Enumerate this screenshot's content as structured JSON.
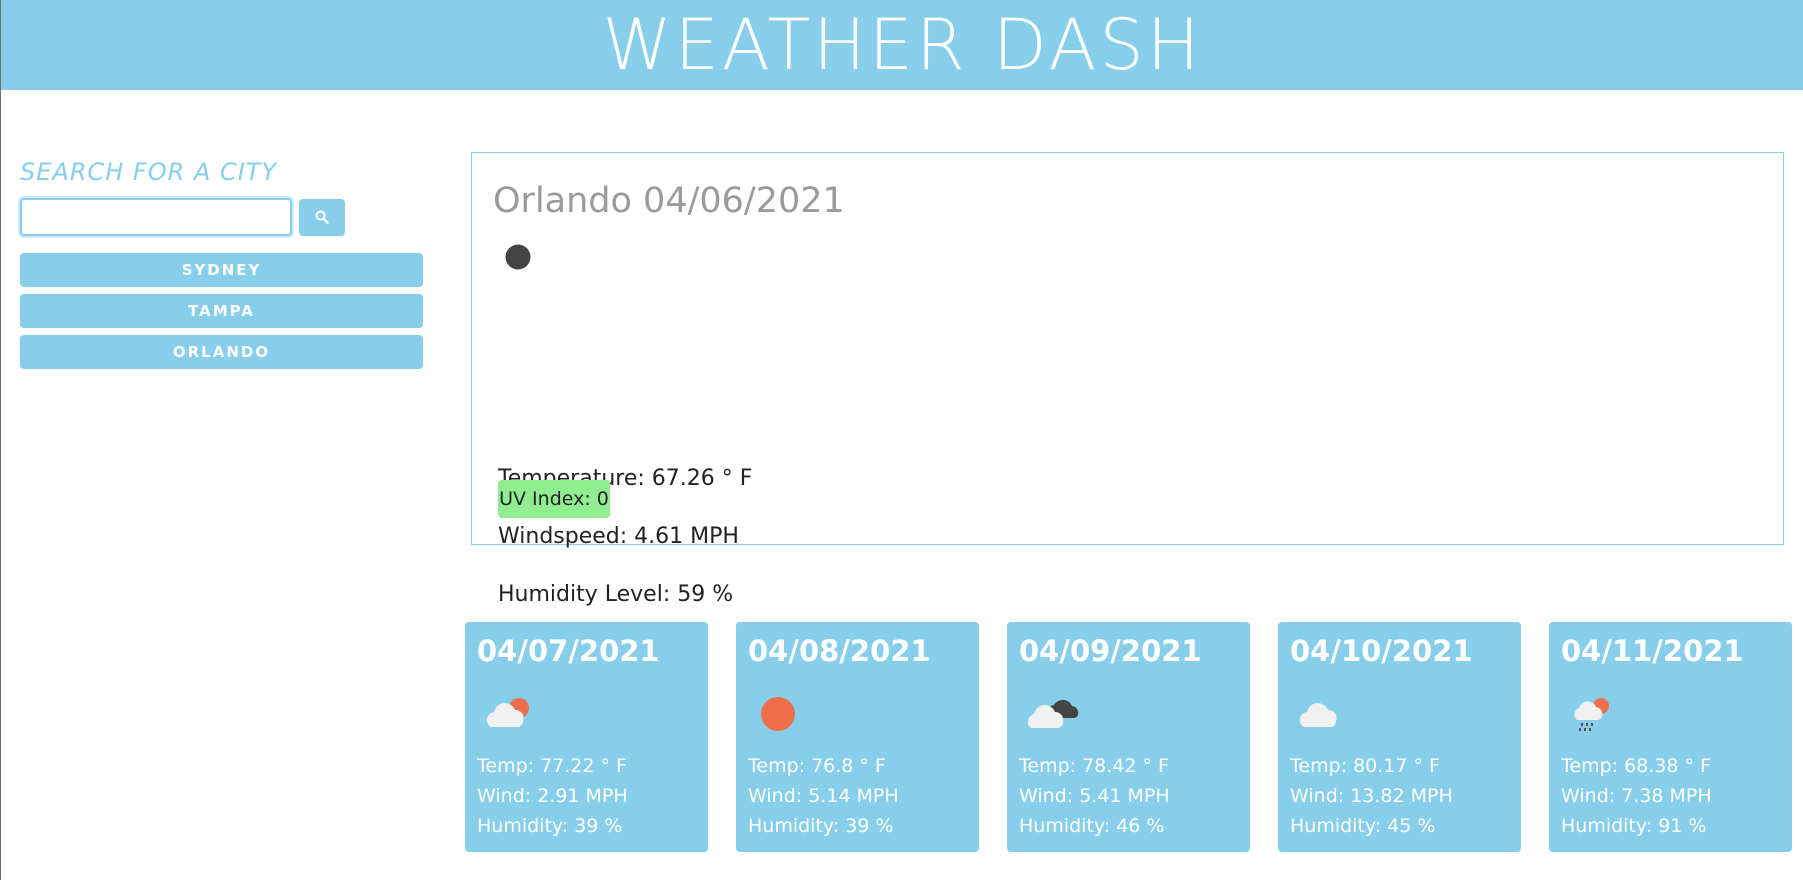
{
  "header": {
    "title": "WEATHER DASH"
  },
  "sidebar": {
    "search_title": "SEARCH FOR A CITY",
    "search_value": "",
    "search_icon": "search-icon",
    "history": [
      "SYDNEY",
      "TAMPA",
      "ORLANDO"
    ]
  },
  "current": {
    "title": "Orlando 04/06/2021",
    "icon": "clear-night-moon-icon",
    "temperature": "Temperature: 67.26 ° F",
    "windspeed": "Windspeed: 4.61 MPH",
    "humidity": "Humidity Level: 59 %",
    "uv": "UV Index: 0"
  },
  "forecast": [
    {
      "date": "04/07/2021",
      "icon": "partly-cloudy-day-icon",
      "temp": "Temp: 77.22 ° F",
      "wind": "Wind: 2.91 MPH",
      "humidity": "Humidity: 39 %"
    },
    {
      "date": "04/08/2021",
      "icon": "sun-icon",
      "temp": "Temp: 76.8 ° F",
      "wind": "Wind: 5.14 MPH",
      "humidity": "Humidity: 39 %"
    },
    {
      "date": "04/09/2021",
      "icon": "broken-clouds-icon",
      "temp": "Temp: 78.42 ° F",
      "wind": "Wind: 5.41 MPH",
      "humidity": "Humidity: 46 %"
    },
    {
      "date": "04/10/2021",
      "icon": "cloud-icon",
      "temp": "Temp: 80.17 ° F",
      "wind": "Wind: 13.82 MPH",
      "humidity": "Humidity: 45 %"
    },
    {
      "date": "04/11/2021",
      "icon": "rain-sun-icon",
      "temp": "Temp: 68.38 ° F",
      "wind": "Wind: 7.38 MPH",
      "humidity": "Humidity: 91 %"
    }
  ],
  "colors": {
    "accent": "#87ceeb",
    "uv_good": "#90ee90",
    "sun": "#ee6e4c",
    "moon": "#444444"
  }
}
